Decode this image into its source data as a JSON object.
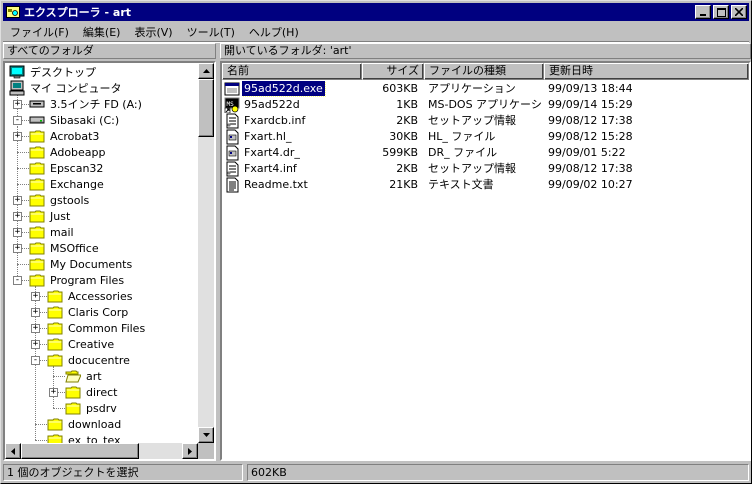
{
  "window": {
    "title": "エクスプローラ - art"
  },
  "menu": [
    "ファイル(F)",
    "編集(E)",
    "表示(V)",
    "ツール(T)",
    "ヘルプ(H)"
  ],
  "left_header": "すべてのフォルダ",
  "right_header": "開いているフォルダ: 'art'",
  "tree": [
    {
      "label": "デスクトップ",
      "level": 0,
      "icon": "desktop-icon",
      "expander": ""
    },
    {
      "label": "マイ コンピュータ",
      "level": 1,
      "icon": "my-computer-icon",
      "expander": "-"
    },
    {
      "label": "3.5インチ FD (A:)",
      "level": 2,
      "icon": "floppy-drive-icon",
      "expander": "+"
    },
    {
      "label": "Sibasaki (C:)",
      "level": 2,
      "icon": "hard-drive-icon",
      "expander": "-"
    },
    {
      "label": "Acrobat3",
      "level": 3,
      "icon": "folder-icon",
      "expander": "+"
    },
    {
      "label": "Adobeapp",
      "level": 3,
      "icon": "folder-icon",
      "expander": ""
    },
    {
      "label": "Epscan32",
      "level": 3,
      "icon": "folder-icon",
      "expander": ""
    },
    {
      "label": "Exchange",
      "level": 3,
      "icon": "folder-icon",
      "expander": ""
    },
    {
      "label": "gstools",
      "level": 3,
      "icon": "folder-icon",
      "expander": "+"
    },
    {
      "label": "Just",
      "level": 3,
      "icon": "folder-icon",
      "expander": "+"
    },
    {
      "label": "mail",
      "level": 3,
      "icon": "folder-icon",
      "expander": "+"
    },
    {
      "label": "MSOffice",
      "level": 3,
      "icon": "folder-icon",
      "expander": "+"
    },
    {
      "label": "My Documents",
      "level": 3,
      "icon": "folder-icon",
      "expander": ""
    },
    {
      "label": "Program Files",
      "level": 3,
      "icon": "folder-icon",
      "expander": "-"
    },
    {
      "label": "Accessories",
      "level": 4,
      "icon": "folder-icon",
      "expander": "+"
    },
    {
      "label": "Claris Corp",
      "level": 4,
      "icon": "folder-icon",
      "expander": "+"
    },
    {
      "label": "Common Files",
      "level": 4,
      "icon": "folder-icon",
      "expander": "+"
    },
    {
      "label": "Creative",
      "level": 4,
      "icon": "folder-icon",
      "expander": "+"
    },
    {
      "label": "docucentre",
      "level": 4,
      "icon": "folder-icon",
      "expander": "-"
    },
    {
      "label": "art",
      "level": 5,
      "icon": "open-folder-icon",
      "expander": ""
    },
    {
      "label": "direct",
      "level": 5,
      "icon": "folder-icon",
      "expander": "+"
    },
    {
      "label": "psdrv",
      "level": 5,
      "icon": "folder-icon",
      "expander": ""
    },
    {
      "label": "download",
      "level": 4,
      "icon": "folder-icon",
      "expander": ""
    },
    {
      "label": "ex_to_tex",
      "level": 4,
      "icon": "folder-icon",
      "expander": ""
    }
  ],
  "columns": {
    "name": "名前",
    "size": "サイズ",
    "type": "ファイルの種類",
    "date": "更新日時"
  },
  "files": [
    {
      "name": "95ad522d.exe",
      "size": "603KB",
      "type": "アプリケーション",
      "date": "99/09/13 18:44",
      "icon": "application-icon",
      "selected": true
    },
    {
      "name": "95ad522d",
      "size": "1KB",
      "type": "MS-DOS アプリケーショ...",
      "date": "99/09/14 15:29",
      "icon": "msdos-shortcut-icon",
      "selected": false
    },
    {
      "name": "Fxardcb.inf",
      "size": "2KB",
      "type": "セットアップ情報",
      "date": "99/08/12 17:38",
      "icon": "setup-info-icon",
      "selected": false
    },
    {
      "name": "Fxart.hl_",
      "size": "30KB",
      "type": "HL_ ファイル",
      "date": "99/08/12 15:28",
      "icon": "generic-file-icon",
      "selected": false
    },
    {
      "name": "Fxart4.dr_",
      "size": "599KB",
      "type": "DR_ ファイル",
      "date": "99/09/01 5:22",
      "icon": "generic-file-icon",
      "selected": false
    },
    {
      "name": "Fxart4.inf",
      "size": "2KB",
      "type": "セットアップ情報",
      "date": "99/08/12 17:38",
      "icon": "setup-info-icon",
      "selected": false
    },
    {
      "name": "Readme.txt",
      "size": "21KB",
      "type": "テキスト文書",
      "date": "99/09/02 10:27",
      "icon": "text-document-icon",
      "selected": false
    }
  ],
  "status": {
    "selection": "1 個のオブジェクトを選択",
    "size": "602KB"
  }
}
